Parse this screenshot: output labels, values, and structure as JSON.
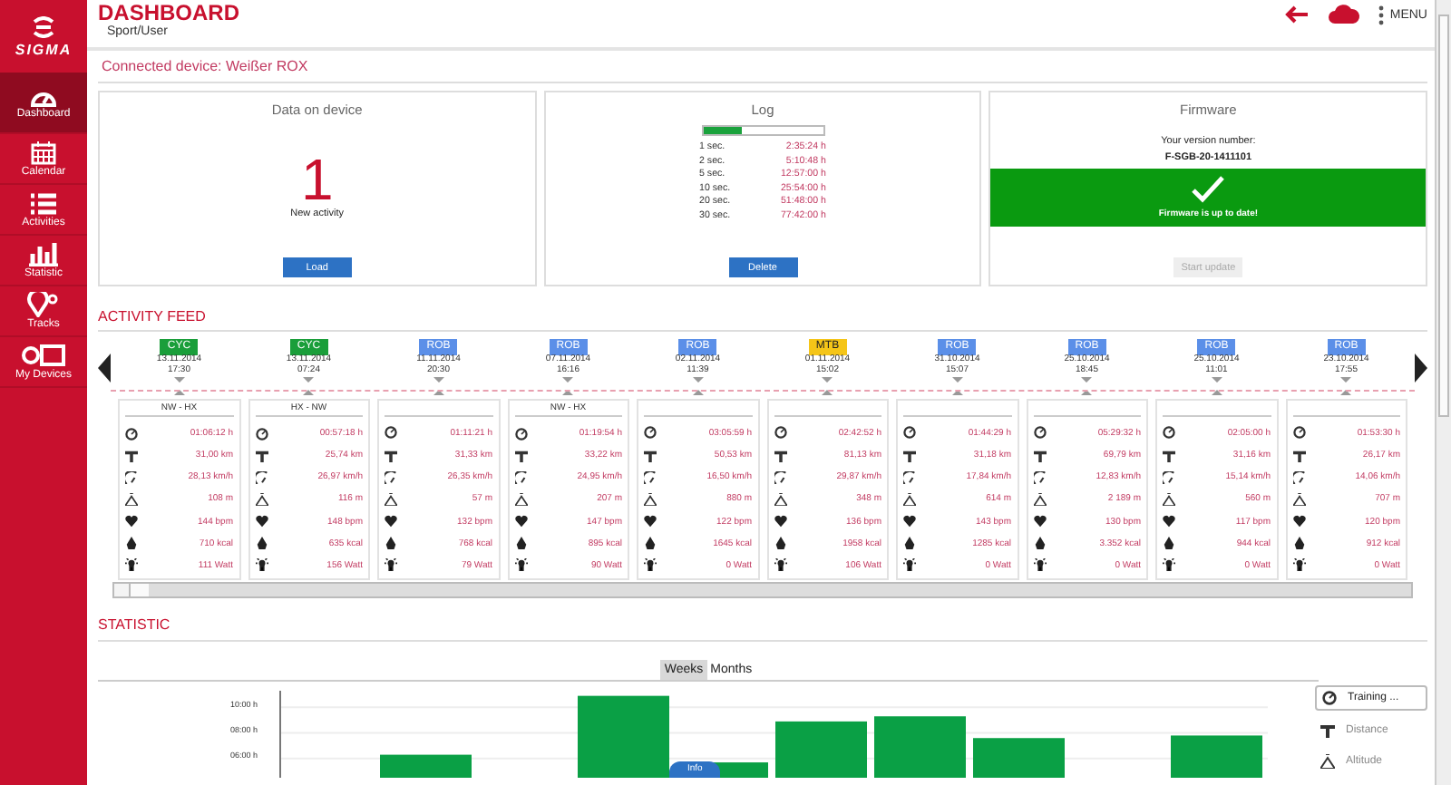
{
  "app": {
    "logo": "SIGMA",
    "title": "DASHBOARD",
    "breadcrumb": "Sport/User",
    "menu": "MENU"
  },
  "sidebar": {
    "items": [
      {
        "label": "Dashboard",
        "selected": true
      },
      {
        "label": "Calendar",
        "selected": false
      },
      {
        "label": "Activities",
        "selected": false
      },
      {
        "label": "Statistic",
        "selected": false
      },
      {
        "label": "Tracks",
        "selected": false
      },
      {
        "label": "My Devices",
        "selected": false
      }
    ]
  },
  "connected_device": "Connected device: Weißer ROX",
  "cards": {
    "data": {
      "title": "Data on device",
      "count": "1",
      "caption": "New activity",
      "button": "Load"
    },
    "log": {
      "title": "Log",
      "level": 0.33,
      "button": "Delete",
      "rows": [
        {
          "interval": "1 sec.",
          "duration": "2:35:24 h"
        },
        {
          "interval": "2 sec.",
          "duration": "5:10:48 h"
        },
        {
          "interval": "5 sec.",
          "duration": "12:57:00 h"
        },
        {
          "interval": "10 sec.",
          "duration": "25:54:00 h"
        },
        {
          "interval": "20 sec.",
          "duration": "51:48:00 h"
        },
        {
          "interval": "30 sec.",
          "duration": "77:42:00 h"
        }
      ]
    },
    "firmware": {
      "title": "Firmware",
      "version_label": "Your version number:",
      "version": "F-SGB-20-1411101",
      "status": "Firmware is up to date!",
      "button": "Start update",
      "button_disabled": true
    }
  },
  "activity_feed": {
    "title": "ACTIVITY FEED",
    "activities": [
      {
        "sport": "CYC",
        "color": "#1a9e3a",
        "date": "13.11.2014",
        "time": "17:30",
        "route": "NW - HX",
        "values": [
          "01:06:12 h",
          "31,00 km",
          "28,13 km/h",
          "108 m",
          "144 bpm",
          "710 kcal",
          "111 Watt"
        ]
      },
      {
        "sport": "CYC",
        "color": "#1a9e3a",
        "date": "13.11.2014",
        "time": "07:24",
        "route": "HX - NW",
        "values": [
          "00:57:18 h",
          "25,74 km",
          "26,97 km/h",
          "116 m",
          "148 bpm",
          "635 kcal",
          "156 Watt"
        ]
      },
      {
        "sport": "ROB",
        "color": "#5b8fe8",
        "date": "11.11.2014",
        "time": "20:30",
        "values": [
          "01:11:21 h",
          "31,33 km",
          "26,35 km/h",
          "57 m",
          "132 bpm",
          "768 kcal",
          "79 Watt"
        ]
      },
      {
        "sport": "ROB",
        "color": "#5b8fe8",
        "date": "07.11.2014",
        "time": "16:16",
        "route": "NW - HX",
        "values": [
          "01:19:54 h",
          "33,22 km",
          "24,95 km/h",
          "207 m",
          "147 bpm",
          "895 kcal",
          "90 Watt"
        ]
      },
      {
        "sport": "ROB",
        "color": "#5b8fe8",
        "date": "02.11.2014",
        "time": "11:39",
        "values": [
          "03:05:59 h",
          "50,53 km",
          "16,50 km/h",
          "880 m",
          "122 bpm",
          "1645 kcal",
          "0 Watt"
        ]
      },
      {
        "sport": "MTB",
        "color": "#f5c518",
        "date": "01.11.2014",
        "time": "15:02",
        "values": [
          "02:42:52 h",
          "81,13 km",
          "29,87 km/h",
          "348 m",
          "136 bpm",
          "1958 kcal",
          "106 Watt"
        ]
      },
      {
        "sport": "ROB",
        "color": "#5b8fe8",
        "date": "31.10.2014",
        "time": "15:07",
        "values": [
          "01:44:29 h",
          "31,18 km",
          "17,84 km/h",
          "614 m",
          "143 bpm",
          "1285 kcal",
          "0 Watt"
        ]
      },
      {
        "sport": "ROB",
        "color": "#5b8fe8",
        "date": "25.10.2014",
        "time": "18:45",
        "values": [
          "05:29:32 h",
          "69,79 km",
          "12,83 km/h",
          "2 189 m",
          "130 bpm",
          "3.352 kcal",
          "0 Watt"
        ]
      },
      {
        "sport": "ROB",
        "color": "#5b8fe8",
        "date": "25.10.2014",
        "time": "11:01",
        "values": [
          "02:05:00 h",
          "31,16 km",
          "15,14 km/h",
          "560 m",
          "117 bpm",
          "944 kcal",
          "0 Watt"
        ]
      },
      {
        "sport": "ROB",
        "color": "#5b8fe8",
        "date": "23.10.2014",
        "time": "17:55",
        "values": [
          "01:53:30 h",
          "26,17 km",
          "14,06 km/h",
          "707 m",
          "120 bpm",
          "912 kcal",
          "0 Watt"
        ]
      }
    ]
  },
  "statistic": {
    "title": "STATISTIC",
    "tabs": [
      {
        "label": "Weeks",
        "selected": true
      },
      {
        "label": "Months",
        "selected": false
      }
    ],
    "y_axis_labels": [
      "10:00 h",
      "08:00 h",
      "06:00 h"
    ],
    "tooltip": "Info",
    "legend": [
      {
        "label": "Training ...",
        "selected": true
      },
      {
        "label": "Distance",
        "selected": false
      },
      {
        "label": "Altitude",
        "selected": false
      }
    ]
  }
}
